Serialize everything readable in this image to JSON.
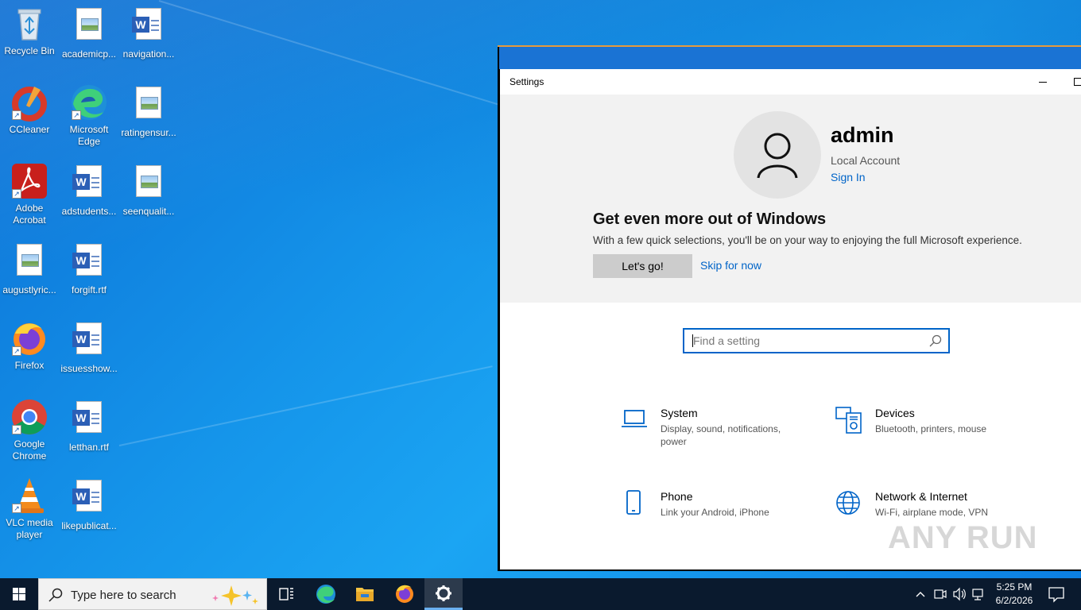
{
  "desktop": {
    "icons": [
      {
        "label": "Recycle Bin"
      },
      {
        "label": "academicp..."
      },
      {
        "label": "navigation..."
      },
      {
        "label": "CCleaner"
      },
      {
        "label": "Microsoft Edge"
      },
      {
        "label": "ratingensur..."
      },
      {
        "label": "Adobe Acrobat"
      },
      {
        "label": "adstudents..."
      },
      {
        "label": "seenqualit..."
      },
      {
        "label": "augustlyric..."
      },
      {
        "label": "forgift.rtf"
      },
      {
        "label": "Firefox"
      },
      {
        "label": "issuesshow..."
      },
      {
        "label": "Google Chrome"
      },
      {
        "label": "letthan.rtf"
      },
      {
        "label": "VLC media player"
      },
      {
        "label": "likepublicat..."
      }
    ]
  },
  "settings": {
    "window_title": "Settings",
    "user": {
      "name": "admin",
      "account_type": "Local Account",
      "sign_in": "Sign In"
    },
    "promo": {
      "heading": "Get even more out of Windows",
      "text": "With a few quick selections, you'll be on your way to enjoying the full Microsoft experience.",
      "primary_button": "Let's go!",
      "secondary_link": "Skip for now"
    },
    "search": {
      "placeholder": "Find a setting"
    },
    "categories": [
      {
        "title": "System",
        "desc": "Display, sound, notifications, power",
        "icon": "laptop-icon"
      },
      {
        "title": "Devices",
        "desc": "Bluetooth, printers, mouse",
        "icon": "devices-icon"
      },
      {
        "title": "Phone",
        "desc": "Link your Android, iPhone",
        "icon": "phone-icon"
      },
      {
        "title": "Network & Internet",
        "desc": "Wi-Fi, airplane mode, VPN",
        "icon": "globe-icon"
      }
    ]
  },
  "watermark": "ANY RUN",
  "taskbar": {
    "search_placeholder": "Type here to search",
    "time": "5:25 PM",
    "date": "6/2/2026"
  },
  "colors": {
    "accent": "#0064c8",
    "taskbar": "#0a1a2e",
    "window_accent": "#e69a3c"
  }
}
